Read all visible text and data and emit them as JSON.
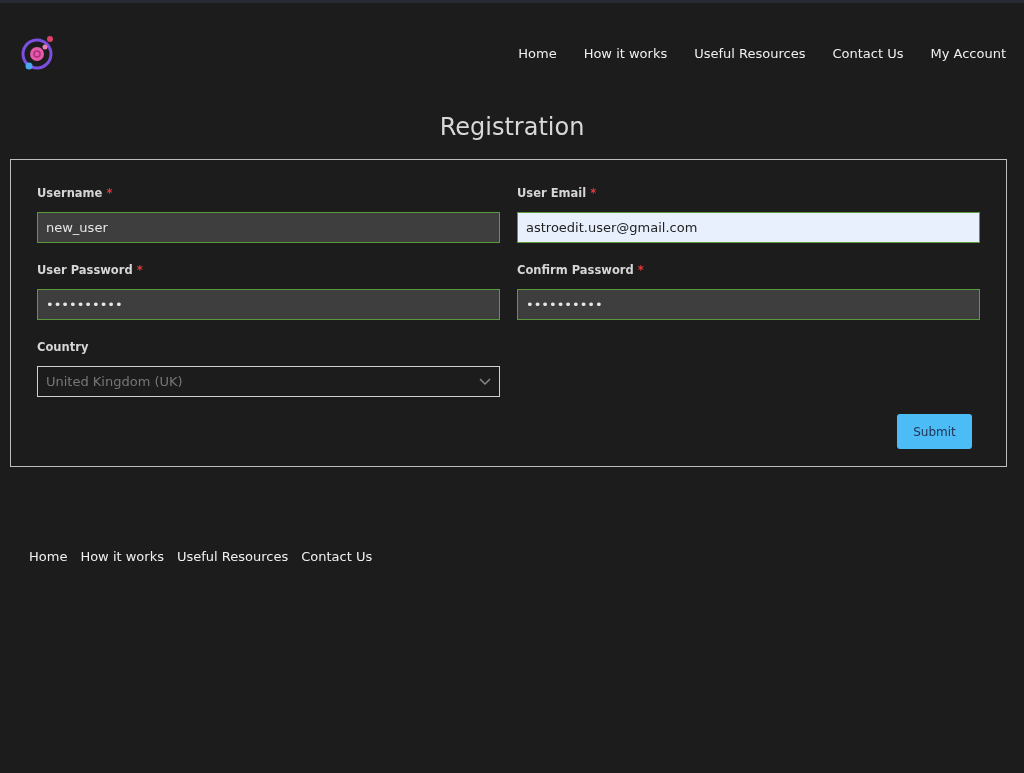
{
  "header": {
    "nav": [
      {
        "label": "Home"
      },
      {
        "label": "How it works"
      },
      {
        "label": "Useful Resources"
      },
      {
        "label": "Contact Us"
      },
      {
        "label": "My Account"
      }
    ]
  },
  "page_title": "Registration",
  "form": {
    "fields": [
      {
        "kind": "text",
        "label": "Username",
        "required_mark": "*",
        "value": "new_user",
        "valid": true,
        "autofilled": false
      },
      {
        "kind": "text",
        "label": "User Email",
        "required_mark": "*",
        "value": "astroedit.user@gmail.com",
        "valid": true,
        "autofilled": true
      },
      {
        "kind": "text",
        "label": "User Password",
        "required_mark": "*",
        "value": "••••••••••",
        "valid": true,
        "autofilled": false
      },
      {
        "kind": "text",
        "label": "Confirm Password",
        "required_mark": "*",
        "value": "••••••••••",
        "valid": true,
        "autofilled": false
      },
      {
        "kind": "select",
        "label": "Country",
        "value": "United Kingdom (UK)",
        "valid": false,
        "autofilled": false
      }
    ],
    "submit": "Submit"
  },
  "footer": {
    "nav": [
      {
        "label": "Home"
      },
      {
        "label": "How it works"
      },
      {
        "label": "Useful Resources"
      },
      {
        "label": "Contact Us"
      }
    ]
  }
}
